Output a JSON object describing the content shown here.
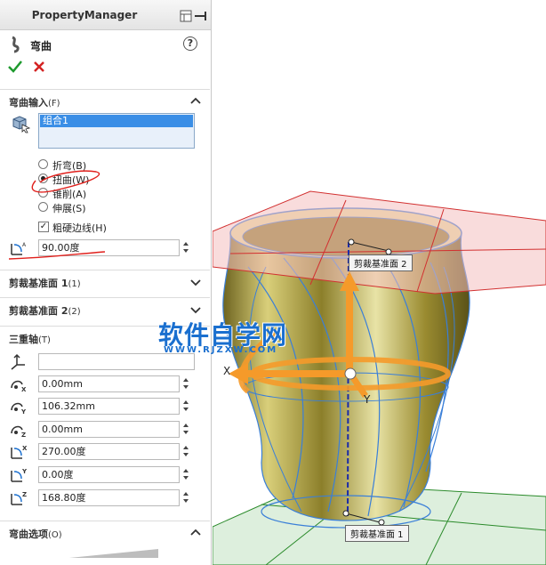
{
  "header": {
    "title": "PropertyManager"
  },
  "feature": {
    "name": "弯曲",
    "help": "?"
  },
  "sections": {
    "bend_input": {
      "label": "弯曲输入",
      "shortcut": "(F)"
    },
    "trim_plane1": {
      "label": "剪裁基准面 1",
      "shortcut": "(1)"
    },
    "trim_plane2": {
      "label": "剪裁基准面 2",
      "shortcut": "(2)"
    },
    "triad": {
      "label": "三重轴",
      "shortcut": "(T)"
    },
    "bend_options": {
      "label": "弯曲选项",
      "shortcut": "(O)"
    }
  },
  "selection": {
    "items": [
      "组合1"
    ]
  },
  "bend_types": [
    {
      "label": "折弯(B)",
      "selected": false
    },
    {
      "label": "扭曲(W)",
      "selected": true
    },
    {
      "label": "锥削(A)",
      "selected": false
    },
    {
      "label": "伸展(S)",
      "selected": false
    }
  ],
  "rigid_edges": {
    "label": "粗硬边线(H)",
    "checked": true
  },
  "angle": {
    "value": "90.00度"
  },
  "triad": {
    "entity": "",
    "x_pos": "0.00mm",
    "y_pos": "106.32mm",
    "z_pos": "0.00mm",
    "x_rot": "270.00度",
    "y_rot": "0.00度",
    "z_rot": "168.80度"
  },
  "viewport": {
    "plane_label_2": "剪裁基准面 2",
    "plane_label_1": "剪裁基准面 1",
    "axis_x": "X",
    "axis_y": "Y"
  },
  "watermark": {
    "main": "软件自学网",
    "sub": "WWW.RJZXW.COM"
  },
  "colors": {
    "accent_selection": "#3a8ee6",
    "annotation_red": "#e0201c",
    "triad_orange": "#f59a2a"
  }
}
